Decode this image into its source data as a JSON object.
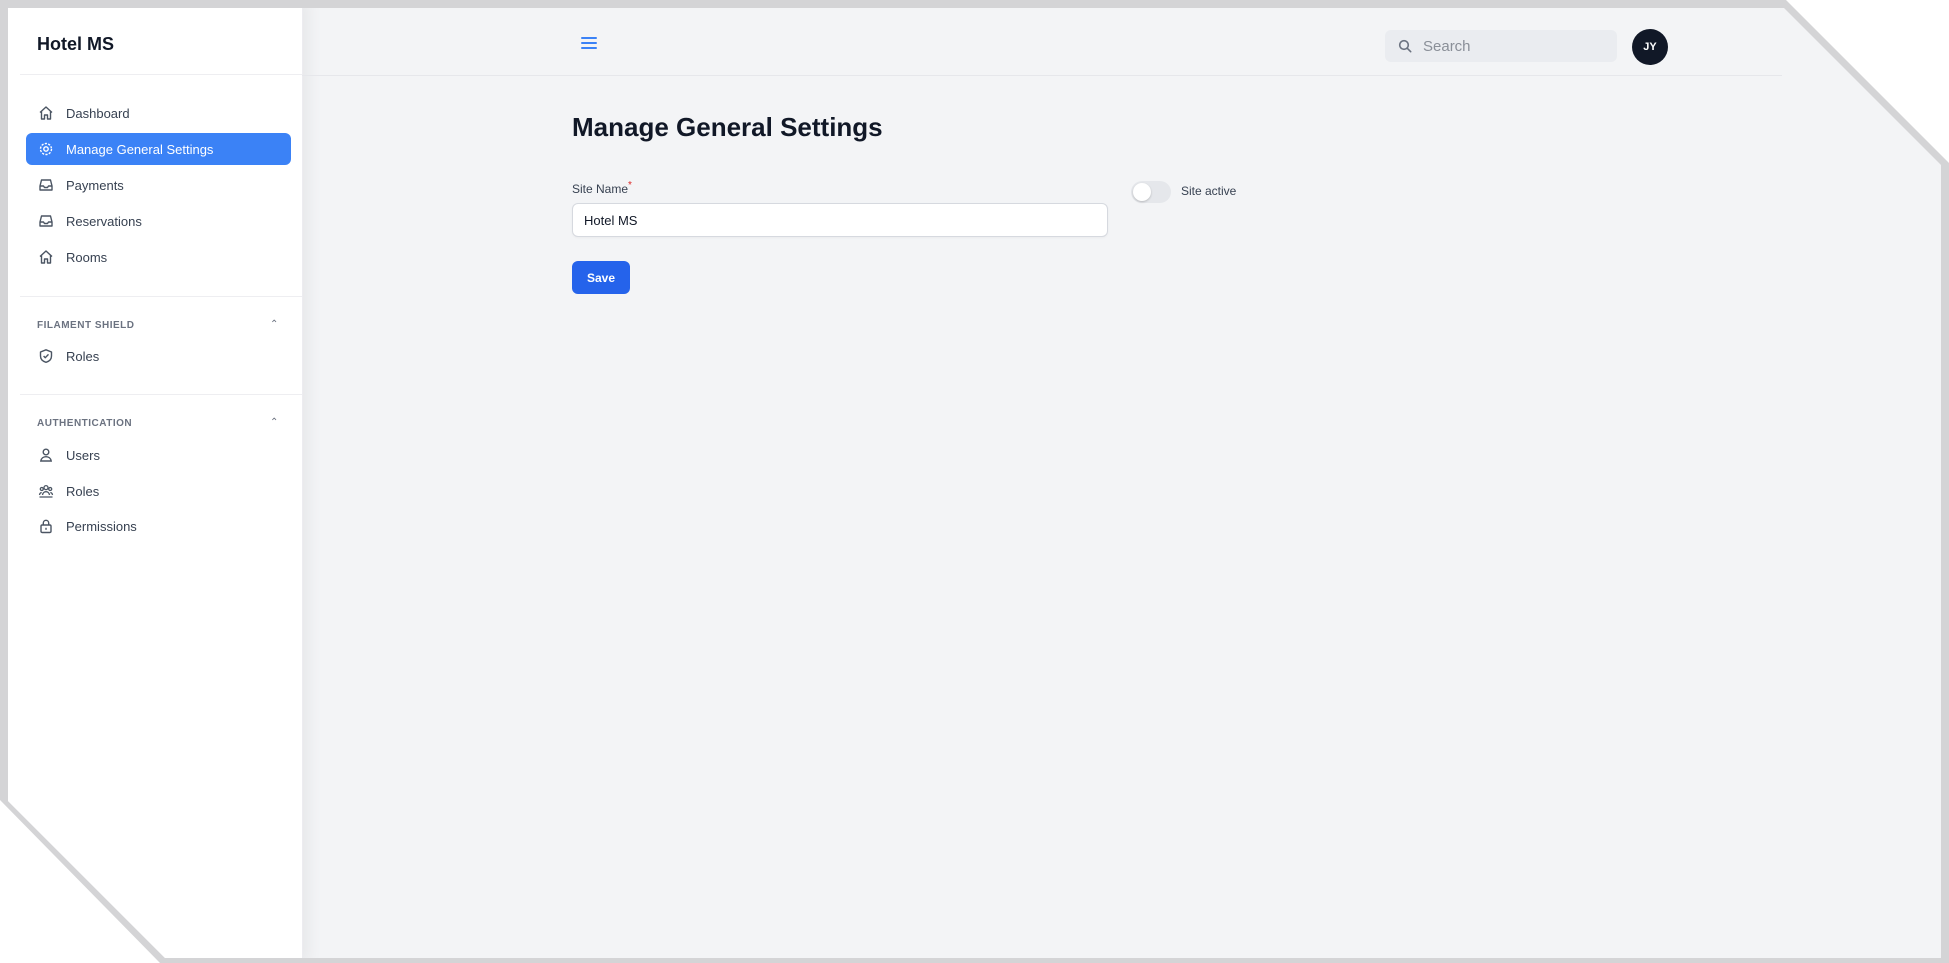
{
  "app": {
    "brand": "Hotel MS"
  },
  "sidebar": {
    "items": [
      {
        "label": "Dashboard",
        "icon": "home-icon"
      },
      {
        "label": "Manage General Settings",
        "icon": "cog-icon",
        "active": true
      },
      {
        "label": "Payments",
        "icon": "inbox-icon"
      },
      {
        "label": "Reservations",
        "icon": "inbox-icon"
      },
      {
        "label": "Rooms",
        "icon": "home-icon"
      }
    ],
    "groups": [
      {
        "label": "FILAMENT SHIELD",
        "items": [
          {
            "label": "Roles",
            "icon": "shield-check-icon"
          }
        ]
      },
      {
        "label": "AUTHENTICATION",
        "items": [
          {
            "label": "Users",
            "icon": "user-icon"
          },
          {
            "label": "Roles",
            "icon": "user-group-icon"
          },
          {
            "label": "Permissions",
            "icon": "lock-icon"
          }
        ]
      }
    ]
  },
  "topbar": {
    "search_placeholder": "Search",
    "avatar_initials": "JY"
  },
  "main": {
    "title": "Manage General Settings",
    "site_name_label": "Site Name",
    "required_marker": "*",
    "site_name_value": "Hotel MS",
    "site_active_label": "Site active",
    "site_active": false,
    "save_label": "Save"
  },
  "colors": {
    "accent": "#3b82f6",
    "button": "#2563eb",
    "page_bg": "#f3f4f6",
    "avatar_bg": "#111827"
  }
}
